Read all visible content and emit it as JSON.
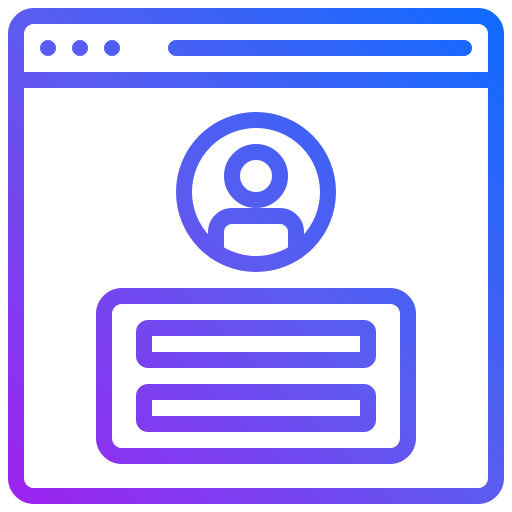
{
  "icon": {
    "name": "web-user-profile-login-icon",
    "gradient": {
      "start": "#a020f0",
      "mid": "#5b5cf0",
      "end": "#0b6cff"
    },
    "background": "#ffffff",
    "parts": [
      "browser-window-icon",
      "window-dot-icon",
      "address-bar-icon",
      "user-avatar-icon",
      "login-form-icon",
      "input-field-icon"
    ]
  }
}
